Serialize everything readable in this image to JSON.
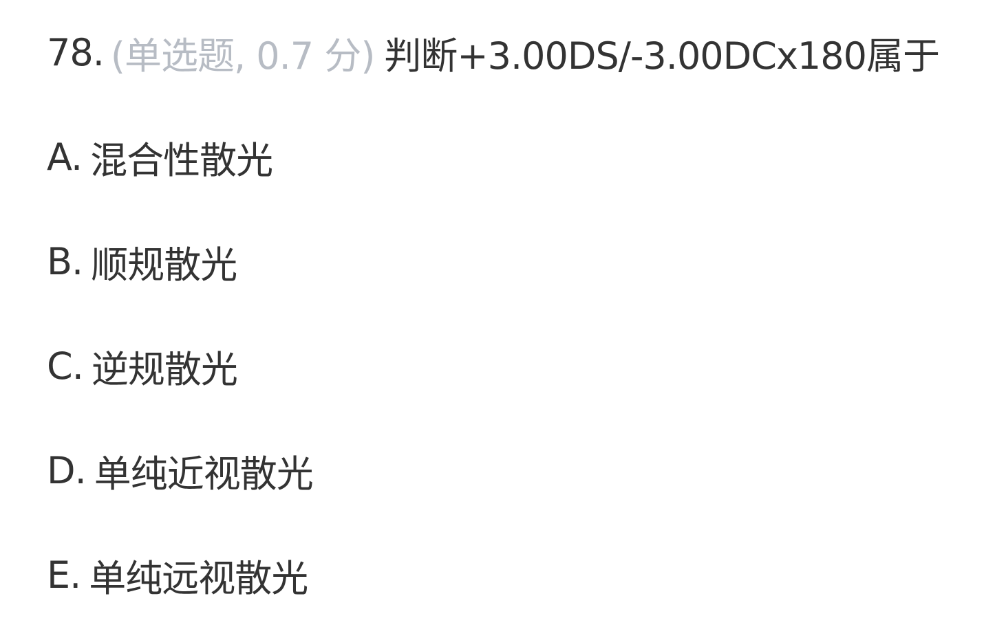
{
  "question": {
    "number": "78.",
    "meta": "(单选题, 0.7 分)",
    "stem": "判断+3.00DS/-3.00DCx180属于"
  },
  "options": [
    {
      "letter": "A.",
      "text": "混合性散光"
    },
    {
      "letter": "B.",
      "text": "顺规散光"
    },
    {
      "letter": "C.",
      "text": "逆规散光"
    },
    {
      "letter": "D.",
      "text": "单纯近视散光"
    },
    {
      "letter": "E.",
      "text": "单纯远视散光"
    }
  ],
  "colors": {
    "text": "#333333",
    "meta": "#b7bcc4",
    "background": "#ffffff"
  }
}
